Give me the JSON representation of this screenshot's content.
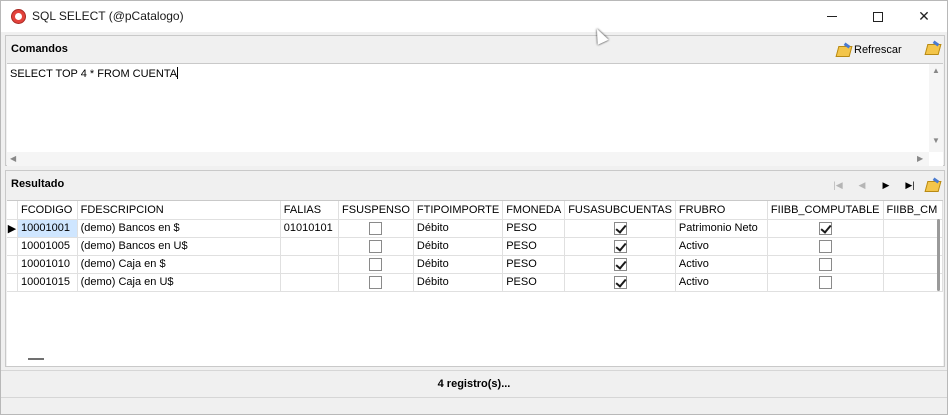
{
  "window": {
    "title": "SQL SELECT (@pCatalogo)"
  },
  "commands": {
    "title": "Comandos",
    "refresh_label": "Refrescar",
    "sql": "SELECT TOP 4 * FROM CUENTA"
  },
  "results": {
    "title": "Resultado",
    "columns": [
      "FCODIGO",
      "FDESCRIPCION",
      "FALIAS",
      "FSUSPENSO",
      "FTIPOIMPORTE",
      "FMONEDA",
      "FUSASUBCUENTAS",
      "FRUBRO",
      "FIIBB_COMPUTABLE",
      "FIIBB_CM"
    ],
    "rows": [
      {
        "codigo": "10001001",
        "descripcion": "(demo) Bancos en $",
        "alias": "01010101",
        "suspenso": false,
        "tipoimporte": "Débito",
        "moneda": "PESO",
        "usasubcuentas": true,
        "rubro": "Patrimonio Neto",
        "iibb_computable": true
      },
      {
        "codigo": "10001005",
        "descripcion": "(demo) Bancos en U$",
        "alias": "",
        "suspenso": false,
        "tipoimporte": "Débito",
        "moneda": "PESO",
        "usasubcuentas": true,
        "rubro": "Activo",
        "iibb_computable": false
      },
      {
        "codigo": "10001010",
        "descripcion": "(demo) Caja en $",
        "alias": "",
        "suspenso": false,
        "tipoimporte": "Débito",
        "moneda": "PESO",
        "usasubcuentas": true,
        "rubro": "Activo",
        "iibb_computable": false
      },
      {
        "codigo": "10001015",
        "descripcion": "(demo) Caja en U$",
        "alias": "",
        "suspenso": false,
        "tipoimporte": "Débito",
        "moneda": "PESO",
        "usasubcuentas": true,
        "rubro": "Activo",
        "iibb_computable": false
      }
    ]
  },
  "status": {
    "text": "4 registro(s)..."
  },
  "icons": {
    "app": "app-logo-icon",
    "refresh": "pencil-refresh-icon",
    "nav_first": "first-record-icon",
    "nav_prev": "previous-record-icon",
    "nav_next": "next-record-icon",
    "nav_last": "last-record-icon"
  },
  "colors": {
    "accent_selection": "#cfe6ff",
    "app_icon": "#e3423b"
  }
}
